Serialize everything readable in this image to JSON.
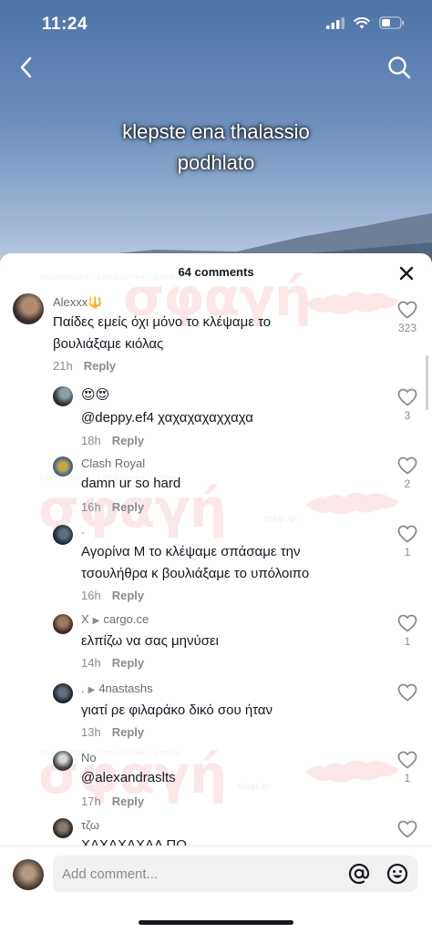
{
  "status": {
    "time": "11:24"
  },
  "video": {
    "caption_line1": "klepste ena thalassio",
    "caption_line2": "podhlato"
  },
  "sheet": {
    "title": "64 comments"
  },
  "watermark": {
    "text": "σφαγή",
    "tagline": "ΕΝΗΜΕΡΩΣΗ · ΑΠΟΚΑΛΥΨΗ · ΑΠΟΨΗ",
    "site": "sfagi.gr"
  },
  "reply_label": "Reply",
  "comments": [
    {
      "username": "Alexxx🔱",
      "lines": [
        "Παίδες εμείς όχι μόνο το κλέψαμε το",
        "βουλιάξαμε κιόλας"
      ],
      "time": "21h",
      "likes": "323"
    },
    {
      "username": "",
      "lines": [
        "😍😍",
        "@deppy.ef4 χαχαχαχαχχαχα"
      ],
      "time": "18h",
      "likes": "3"
    },
    {
      "username": "Clash Royal",
      "lines": [
        "damn ur so hard"
      ],
      "time": "16h",
      "likes": "2"
    },
    {
      "username": ".",
      "lines": [
        "Αγορίνα Μ το κλέψαμε σπάσαμε την",
        "τσουλήθρα κ βουλιάξαμε το υπόλοιπο"
      ],
      "time": "16h",
      "likes": "1"
    },
    {
      "username": "X",
      "reply_to": "cargo.ce",
      "lines": [
        "ελπίζω να σας μηνύσει"
      ],
      "time": "14h",
      "likes": "1"
    },
    {
      "username": ".",
      "reply_to": "4nastashs",
      "lines": [
        "γιατί ρε φιλαράκο δικό σου ήταν"
      ],
      "time": "13h",
      "likes": ""
    },
    {
      "username": "No",
      "lines": [
        "@alexandraslts"
      ],
      "time": "17h",
      "likes": "1"
    },
    {
      "username": "τζω",
      "lines": [
        "ΧΑΧΑΧΑΧΑΛ ΠΟ"
      ],
      "time": "",
      "likes": ""
    }
  ],
  "input": {
    "placeholder": "Add comment..."
  },
  "icons": {
    "back": "chevron-left-icon",
    "search": "search-icon",
    "close": "close-icon",
    "like": "heart-outline-icon",
    "mention": "at-icon",
    "emoji": "smiley-icon"
  }
}
